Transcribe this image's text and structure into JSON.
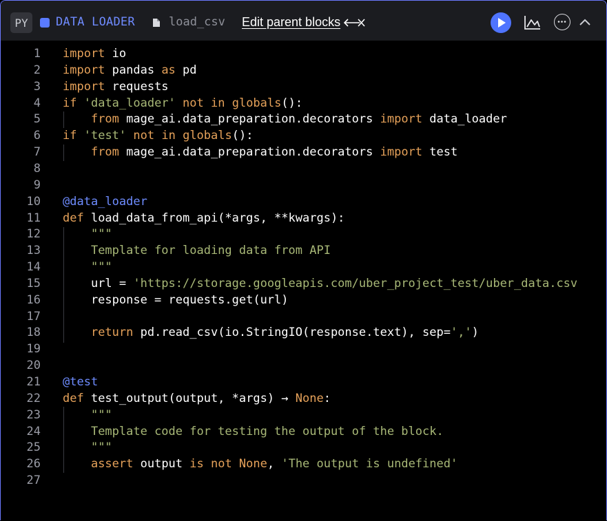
{
  "header": {
    "lang_badge": "PY",
    "block_type": "DATA LOADER",
    "file_name": "load_csv",
    "parent_link": "Edit parent blocks",
    "accent_color": "#4f74ff"
  },
  "icons": {
    "run": "play-icon",
    "chart": "chart-icon",
    "more": "more-icon",
    "collapse": "chevron-up-icon",
    "file": "file-icon",
    "arrow": "bidirectional-arrow-icon"
  },
  "editor": {
    "line_numbers": [
      "1",
      "2",
      "3",
      "4",
      "5",
      "6",
      "7",
      "8",
      "9",
      "10",
      "11",
      "12",
      "13",
      "14",
      "15",
      "16",
      "17",
      "18",
      "19",
      "20",
      "21",
      "22",
      "23",
      "24",
      "25",
      "26",
      "27"
    ],
    "lines": [
      [
        [
          "kw",
          "import"
        ],
        [
          "t",
          " io"
        ]
      ],
      [
        [
          "kw",
          "import"
        ],
        [
          "t",
          " pandas "
        ],
        [
          "kw",
          "as"
        ],
        [
          "t",
          " pd"
        ]
      ],
      [
        [
          "kw",
          "import"
        ],
        [
          "t",
          " requests"
        ]
      ],
      [
        [
          "kw",
          "if"
        ],
        [
          "t",
          " "
        ],
        [
          "str",
          "'data_loader'"
        ],
        [
          "t",
          " "
        ],
        [
          "kw",
          "not in"
        ],
        [
          "t",
          " "
        ],
        [
          "kw",
          "globals"
        ],
        [
          "t",
          "():"
        ]
      ],
      [
        [
          "t",
          "    "
        ],
        [
          "kw",
          "from"
        ],
        [
          "t",
          " mage_ai.data_preparation.decorators "
        ],
        [
          "kw",
          "import"
        ],
        [
          "t",
          " data_loader"
        ]
      ],
      [
        [
          "kw",
          "if"
        ],
        [
          "t",
          " "
        ],
        [
          "str",
          "'test'"
        ],
        [
          "t",
          " "
        ],
        [
          "kw",
          "not in"
        ],
        [
          "t",
          " "
        ],
        [
          "kw",
          "globals"
        ],
        [
          "t",
          "():"
        ]
      ],
      [
        [
          "t",
          "    "
        ],
        [
          "kw",
          "from"
        ],
        [
          "t",
          " mage_ai.data_preparation.decorators "
        ],
        [
          "kw",
          "import"
        ],
        [
          "t",
          " test"
        ]
      ],
      [],
      [],
      [
        [
          "dec",
          "@data_loader"
        ]
      ],
      [
        [
          "kw",
          "def"
        ],
        [
          "t",
          " load_data_from_api(*args, **kwargs):"
        ]
      ],
      [
        [
          "t",
          "    "
        ],
        [
          "doc",
          "\"\"\""
        ]
      ],
      [
        [
          "t",
          "    "
        ],
        [
          "doc",
          "Template for loading data from API"
        ]
      ],
      [
        [
          "t",
          "    "
        ],
        [
          "doc",
          "\"\"\""
        ]
      ],
      [
        [
          "t",
          "    url = "
        ],
        [
          "str",
          "'https://storage.googleapis.com/uber_project_test/uber_data.csv"
        ]
      ],
      [
        [
          "t",
          "    response = requests.get(url)"
        ]
      ],
      [],
      [
        [
          "t",
          "    "
        ],
        [
          "kw",
          "return"
        ],
        [
          "t",
          " pd.read_csv(io.StringIO(response.text), sep="
        ],
        [
          "str",
          "','"
        ],
        [
          "t",
          ")"
        ]
      ],
      [],
      [],
      [
        [
          "dec",
          "@test"
        ]
      ],
      [
        [
          "kw",
          "def"
        ],
        [
          "t",
          " test_output(output, *args) → "
        ],
        [
          "kw",
          "None"
        ],
        [
          "t",
          ":"
        ]
      ],
      [
        [
          "t",
          "    "
        ],
        [
          "doc",
          "\"\"\""
        ]
      ],
      [
        [
          "t",
          "    "
        ],
        [
          "doc",
          "Template code for testing the output of the block."
        ]
      ],
      [
        [
          "t",
          "    "
        ],
        [
          "doc",
          "\"\"\""
        ]
      ],
      [
        [
          "t",
          "    "
        ],
        [
          "kw",
          "assert"
        ],
        [
          "t",
          " output "
        ],
        [
          "kw",
          "is not None"
        ],
        [
          "t",
          ", "
        ],
        [
          "str",
          "'The output is undefined'"
        ]
      ],
      []
    ]
  }
}
